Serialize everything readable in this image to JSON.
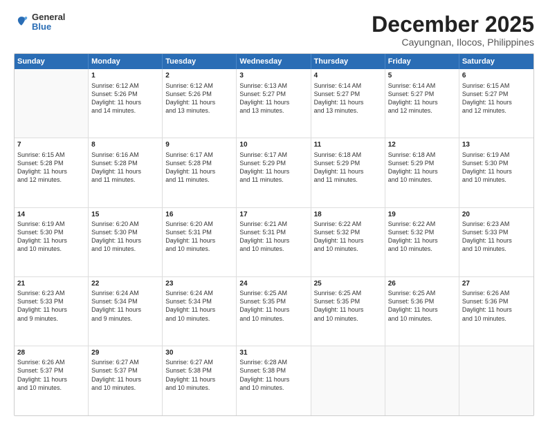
{
  "logo": {
    "general": "General",
    "blue": "Blue"
  },
  "title": "December 2025",
  "location": "Cayungnan, Ilocos, Philippines",
  "headers": [
    "Sunday",
    "Monday",
    "Tuesday",
    "Wednesday",
    "Thursday",
    "Friday",
    "Saturday"
  ],
  "weeks": [
    [
      {
        "day": "",
        "empty": true
      },
      {
        "day": "1",
        "sunrise": "Sunrise: 6:12 AM",
        "sunset": "Sunset: 5:26 PM",
        "daylight": "Daylight: 11 hours and 14 minutes."
      },
      {
        "day": "2",
        "sunrise": "Sunrise: 6:12 AM",
        "sunset": "Sunset: 5:26 PM",
        "daylight": "Daylight: 11 hours and 13 minutes."
      },
      {
        "day": "3",
        "sunrise": "Sunrise: 6:13 AM",
        "sunset": "Sunset: 5:27 PM",
        "daylight": "Daylight: 11 hours and 13 minutes."
      },
      {
        "day": "4",
        "sunrise": "Sunrise: 6:14 AM",
        "sunset": "Sunset: 5:27 PM",
        "daylight": "Daylight: 11 hours and 13 minutes."
      },
      {
        "day": "5",
        "sunrise": "Sunrise: 6:14 AM",
        "sunset": "Sunset: 5:27 PM",
        "daylight": "Daylight: 11 hours and 12 minutes."
      },
      {
        "day": "6",
        "sunrise": "Sunrise: 6:15 AM",
        "sunset": "Sunset: 5:27 PM",
        "daylight": "Daylight: 11 hours and 12 minutes."
      }
    ],
    [
      {
        "day": "7",
        "sunrise": "Sunrise: 6:15 AM",
        "sunset": "Sunset: 5:28 PM",
        "daylight": "Daylight: 11 hours and 12 minutes."
      },
      {
        "day": "8",
        "sunrise": "Sunrise: 6:16 AM",
        "sunset": "Sunset: 5:28 PM",
        "daylight": "Daylight: 11 hours and 11 minutes."
      },
      {
        "day": "9",
        "sunrise": "Sunrise: 6:17 AM",
        "sunset": "Sunset: 5:28 PM",
        "daylight": "Daylight: 11 hours and 11 minutes."
      },
      {
        "day": "10",
        "sunrise": "Sunrise: 6:17 AM",
        "sunset": "Sunset: 5:29 PM",
        "daylight": "Daylight: 11 hours and 11 minutes."
      },
      {
        "day": "11",
        "sunrise": "Sunrise: 6:18 AM",
        "sunset": "Sunset: 5:29 PM",
        "daylight": "Daylight: 11 hours and 11 minutes."
      },
      {
        "day": "12",
        "sunrise": "Sunrise: 6:18 AM",
        "sunset": "Sunset: 5:29 PM",
        "daylight": "Daylight: 11 hours and 10 minutes."
      },
      {
        "day": "13",
        "sunrise": "Sunrise: 6:19 AM",
        "sunset": "Sunset: 5:30 PM",
        "daylight": "Daylight: 11 hours and 10 minutes."
      }
    ],
    [
      {
        "day": "14",
        "sunrise": "Sunrise: 6:19 AM",
        "sunset": "Sunset: 5:30 PM",
        "daylight": "Daylight: 11 hours and 10 minutes."
      },
      {
        "day": "15",
        "sunrise": "Sunrise: 6:20 AM",
        "sunset": "Sunset: 5:30 PM",
        "daylight": "Daylight: 11 hours and 10 minutes."
      },
      {
        "day": "16",
        "sunrise": "Sunrise: 6:20 AM",
        "sunset": "Sunset: 5:31 PM",
        "daylight": "Daylight: 11 hours and 10 minutes."
      },
      {
        "day": "17",
        "sunrise": "Sunrise: 6:21 AM",
        "sunset": "Sunset: 5:31 PM",
        "daylight": "Daylight: 11 hours and 10 minutes."
      },
      {
        "day": "18",
        "sunrise": "Sunrise: 6:22 AM",
        "sunset": "Sunset: 5:32 PM",
        "daylight": "Daylight: 11 hours and 10 minutes."
      },
      {
        "day": "19",
        "sunrise": "Sunrise: 6:22 AM",
        "sunset": "Sunset: 5:32 PM",
        "daylight": "Daylight: 11 hours and 10 minutes."
      },
      {
        "day": "20",
        "sunrise": "Sunrise: 6:23 AM",
        "sunset": "Sunset: 5:33 PM",
        "daylight": "Daylight: 11 hours and 10 minutes."
      }
    ],
    [
      {
        "day": "21",
        "sunrise": "Sunrise: 6:23 AM",
        "sunset": "Sunset: 5:33 PM",
        "daylight": "Daylight: 11 hours and 9 minutes."
      },
      {
        "day": "22",
        "sunrise": "Sunrise: 6:24 AM",
        "sunset": "Sunset: 5:34 PM",
        "daylight": "Daylight: 11 hours and 9 minutes."
      },
      {
        "day": "23",
        "sunrise": "Sunrise: 6:24 AM",
        "sunset": "Sunset: 5:34 PM",
        "daylight": "Daylight: 11 hours and 10 minutes."
      },
      {
        "day": "24",
        "sunrise": "Sunrise: 6:25 AM",
        "sunset": "Sunset: 5:35 PM",
        "daylight": "Daylight: 11 hours and 10 minutes."
      },
      {
        "day": "25",
        "sunrise": "Sunrise: 6:25 AM",
        "sunset": "Sunset: 5:35 PM",
        "daylight": "Daylight: 11 hours and 10 minutes."
      },
      {
        "day": "26",
        "sunrise": "Sunrise: 6:25 AM",
        "sunset": "Sunset: 5:36 PM",
        "daylight": "Daylight: 11 hours and 10 minutes."
      },
      {
        "day": "27",
        "sunrise": "Sunrise: 6:26 AM",
        "sunset": "Sunset: 5:36 PM",
        "daylight": "Daylight: 11 hours and 10 minutes."
      }
    ],
    [
      {
        "day": "28",
        "sunrise": "Sunrise: 6:26 AM",
        "sunset": "Sunset: 5:37 PM",
        "daylight": "Daylight: 11 hours and 10 minutes."
      },
      {
        "day": "29",
        "sunrise": "Sunrise: 6:27 AM",
        "sunset": "Sunset: 5:37 PM",
        "daylight": "Daylight: 11 hours and 10 minutes."
      },
      {
        "day": "30",
        "sunrise": "Sunrise: 6:27 AM",
        "sunset": "Sunset: 5:38 PM",
        "daylight": "Daylight: 11 hours and 10 minutes."
      },
      {
        "day": "31",
        "sunrise": "Sunrise: 6:28 AM",
        "sunset": "Sunset: 5:38 PM",
        "daylight": "Daylight: 11 hours and 10 minutes."
      },
      {
        "day": "",
        "empty": true
      },
      {
        "day": "",
        "empty": true
      },
      {
        "day": "",
        "empty": true
      }
    ]
  ]
}
